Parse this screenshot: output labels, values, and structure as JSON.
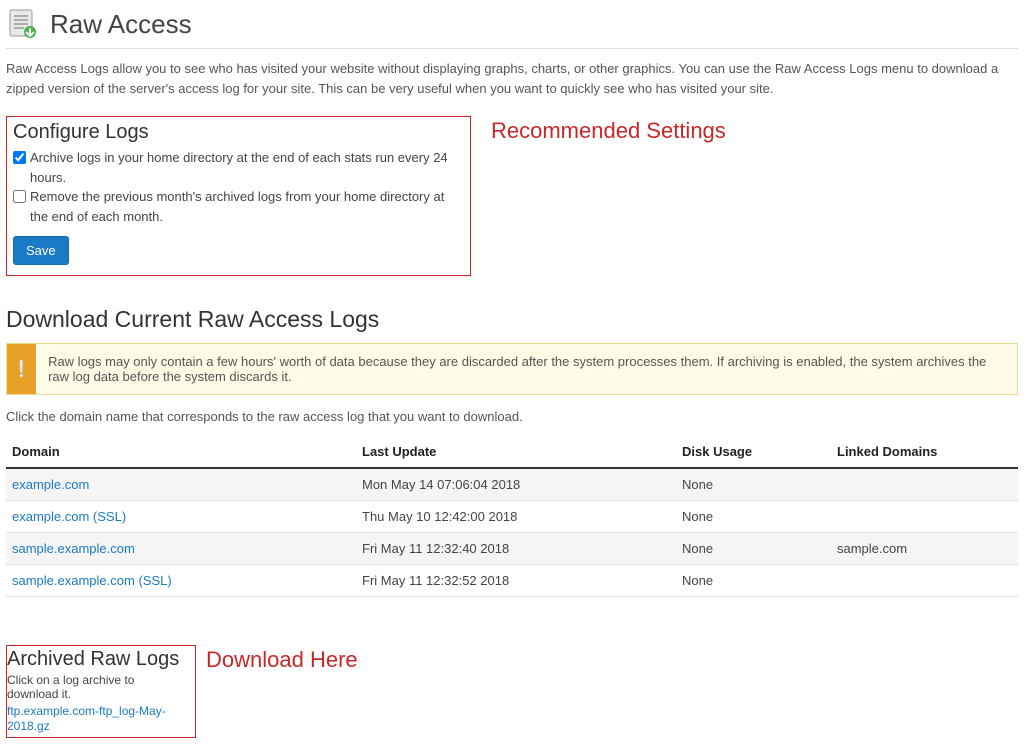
{
  "header": {
    "title": "Raw Access"
  },
  "intro": "Raw Access Logs allow you to see who has visited your website without displaying graphs, charts, or other graphics. You can use the Raw Access Logs menu to download a zipped version of the server's access log for your site. This can be very useful when you want to quickly see who has visited your site.",
  "configure": {
    "heading": "Configure Logs",
    "archive_label": "Archive logs in your home directory at the end of each stats run every 24 hours.",
    "archive_checked": true,
    "remove_label": "Remove the previous month's archived logs from your home directory at the end of each month.",
    "remove_checked": false,
    "save_label": "Save"
  },
  "annotations": {
    "recommended": "Recommended Settings",
    "download_here": "Download Here"
  },
  "download": {
    "heading": "Download Current Raw Access Logs",
    "notice": "Raw logs may only contain a few hours' worth of data because they are discarded after the system processes them. If archiving is enabled, the system archives the raw log data before the system discards it.",
    "instruction": "Click the domain name that corresponds to the raw access log that you want to download.",
    "columns": {
      "domain": "Domain",
      "last_update": "Last Update",
      "disk_usage": "Disk Usage",
      "linked": "Linked Domains"
    },
    "rows": [
      {
        "domain": "example.com",
        "last_update": "Mon May 14 07:06:04 2018",
        "disk_usage": "None",
        "linked": ""
      },
      {
        "domain": "example.com (SSL)",
        "last_update": "Thu May 10 12:42:00 2018",
        "disk_usage": "None",
        "linked": ""
      },
      {
        "domain": "sample.example.com",
        "last_update": "Fri May 11 12:32:40 2018",
        "disk_usage": "None",
        "linked": "sample.com"
      },
      {
        "domain": "sample.example.com (SSL)",
        "last_update": "Fri May 11 12:32:52 2018",
        "disk_usage": "None",
        "linked": ""
      }
    ]
  },
  "archived": {
    "heading": "Archived Raw Logs",
    "instruction": "Click on a log archive to download it.",
    "file": "ftp.example.com-ftp_log-May-2018.gz"
  }
}
